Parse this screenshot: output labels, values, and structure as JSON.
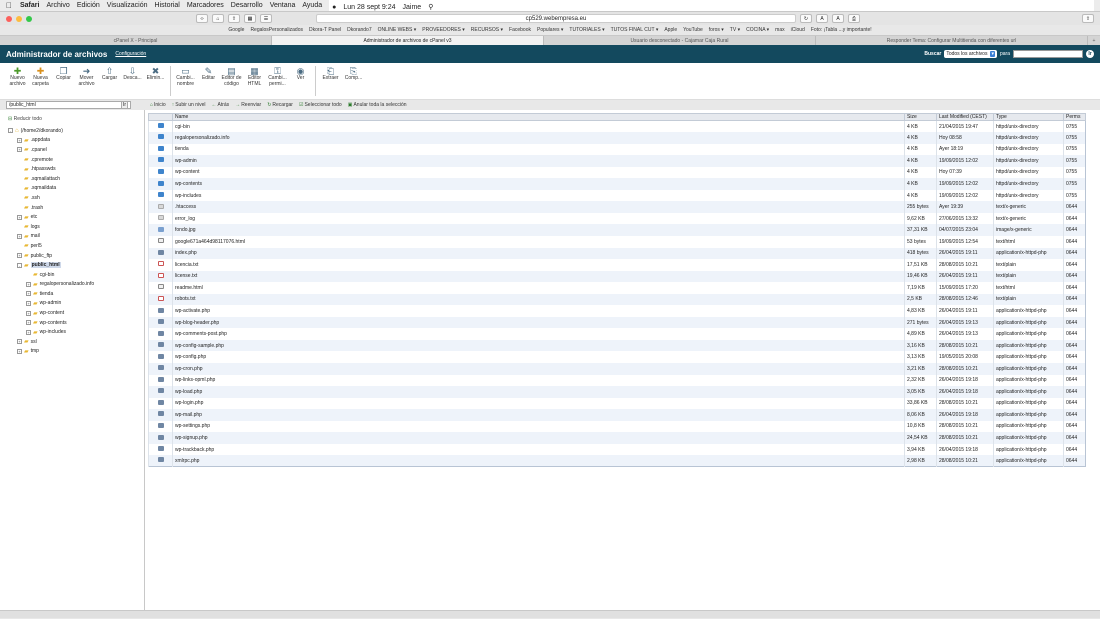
{
  "menubar": {
    "app": "Safari",
    "items": [
      "Archivo",
      "Edición",
      "Visualización",
      "Historial",
      "Marcadores",
      "Desarrollo",
      "Ventana",
      "Ayuda"
    ],
    "datetime": "Lun 28 sept 9:24",
    "user": "Jaime"
  },
  "safari": {
    "url": "cp529.webempresa.eu",
    "bookmarks": [
      "Google",
      "RegalosPersonalizados",
      "Dkora-T Panel",
      "Dkorando7",
      "ONLINE WEBS ▾",
      "PROVEEDORES ▾",
      "RECURSOS ▾",
      "Facebook",
      "Populares ▾",
      "TUTORIALES ▾",
      "TUTOS FINAL CUT ▾",
      "Apple",
      "YouTube",
      "foros ▾",
      "TV ▾",
      "COCINA ▾",
      "max",
      "iCloud",
      "Foto: ¡Tabla ...y importante!"
    ],
    "tabs": [
      {
        "label": "cPanel X - Principal",
        "active": false
      },
      {
        "label": "Administrador de archivos de cPanel v3",
        "active": true
      },
      {
        "label": "Usuario desconectado - Cajamar Caja Rural",
        "active": false
      },
      {
        "label": "Responder Tema: Configurar Multitienda con diferentes url",
        "active": false
      }
    ]
  },
  "header": {
    "title": "Administrador de archivos",
    "config_link": "Configuración",
    "search_label": "Buscar",
    "search_scope": "Todos los archivos",
    "for_label": "para",
    "go": "Ir"
  },
  "actions": [
    {
      "label": "Nuevo archivo",
      "icon": "new-file-icon",
      "color": "green"
    },
    {
      "label": "Nueva carpeta",
      "icon": "new-folder-icon",
      "color": "orange"
    },
    {
      "label": "Copiar",
      "icon": "copy-icon",
      "color": ""
    },
    {
      "label": "Mover archivo",
      "icon": "move-icon",
      "color": ""
    },
    {
      "label": "Cargar",
      "icon": "upload-icon",
      "color": ""
    },
    {
      "label": "Desca...",
      "icon": "download-icon",
      "color": ""
    },
    {
      "label": "Elimin...",
      "icon": "delete-icon",
      "color": ""
    },
    {
      "label": "Cambi... nombre",
      "icon": "rename-icon",
      "color": ""
    },
    {
      "label": "Editar",
      "icon": "edit-icon",
      "color": ""
    },
    {
      "label": "Editor de código",
      "icon": "code-editor-icon",
      "color": ""
    },
    {
      "label": "Editor HTML",
      "icon": "html-editor-icon",
      "color": ""
    },
    {
      "label": "Cambi... permi...",
      "icon": "permissions-icon",
      "color": ""
    },
    {
      "label": "Ver",
      "icon": "view-icon",
      "color": ""
    },
    {
      "label": "Extraer",
      "icon": "extract-icon",
      "color": ""
    },
    {
      "label": "Comp...",
      "icon": "compress-icon",
      "color": ""
    }
  ],
  "path_input": "/public_html",
  "path_go": "Ir",
  "navbar": [
    "Inicio",
    "Subir un nivel",
    "Atrás",
    "Reenviar",
    "Recargar",
    "Seleccionar todo",
    "Anular toda la selección"
  ],
  "tree": {
    "collapse_label": "Reducir todo",
    "items": [
      {
        "label": "(/home2/dkorando)",
        "indent": 0,
        "pm": "-",
        "selected": false
      },
      {
        "label": ".appdata",
        "indent": 1,
        "pm": "+",
        "selected": false
      },
      {
        "label": ".cpanel",
        "indent": 1,
        "pm": "+",
        "selected": false
      },
      {
        "label": ".cpremote",
        "indent": 1,
        "pm": "",
        "selected": false
      },
      {
        "label": ".htpasswds",
        "indent": 1,
        "pm": "",
        "selected": false
      },
      {
        "label": ".sqmailattach",
        "indent": 1,
        "pm": "",
        "selected": false
      },
      {
        "label": ".sqmaildata",
        "indent": 1,
        "pm": "",
        "selected": false
      },
      {
        "label": ".ssh",
        "indent": 1,
        "pm": "",
        "selected": false
      },
      {
        "label": ".trash",
        "indent": 1,
        "pm": "",
        "selected": false
      },
      {
        "label": "etc",
        "indent": 1,
        "pm": "+",
        "selected": false
      },
      {
        "label": "logs",
        "indent": 1,
        "pm": "",
        "selected": false
      },
      {
        "label": "mail",
        "indent": 1,
        "pm": "+",
        "selected": false
      },
      {
        "label": "perl5",
        "indent": 1,
        "pm": "",
        "selected": false
      },
      {
        "label": "public_ftp",
        "indent": 1,
        "pm": "+",
        "selected": false
      },
      {
        "label": "public_html",
        "indent": 1,
        "pm": "-",
        "selected": true
      },
      {
        "label": "cgi-bin",
        "indent": 2,
        "pm": "",
        "selected": false
      },
      {
        "label": "regalopersonalizado.info",
        "indent": 2,
        "pm": "+",
        "selected": false
      },
      {
        "label": "tienda",
        "indent": 2,
        "pm": "+",
        "selected": false
      },
      {
        "label": "wp-admin",
        "indent": 2,
        "pm": "+",
        "selected": false
      },
      {
        "label": "wp-content",
        "indent": 2,
        "pm": "+",
        "selected": false
      },
      {
        "label": "wp-contents",
        "indent": 2,
        "pm": "+",
        "selected": false
      },
      {
        "label": "wp-includes",
        "indent": 2,
        "pm": "+",
        "selected": false
      },
      {
        "label": "ssl",
        "indent": 1,
        "pm": "+",
        "selected": false
      },
      {
        "label": "tmp",
        "indent": 1,
        "pm": "+",
        "selected": false
      }
    ]
  },
  "table": {
    "headers": [
      "Name",
      "Size",
      "Last Modified (CEST)",
      "Type",
      "Perms"
    ],
    "rows": [
      {
        "icon": "folder",
        "name": "cgi-bin",
        "size": "4 KB",
        "modified": "21/04/2015 19:47",
        "type": "httpd/unix-directory",
        "perms": "0755"
      },
      {
        "icon": "folder",
        "name": "regalopersonalizado.info",
        "size": "4 KB",
        "modified": "Hoy 08:58",
        "type": "httpd/unix-directory",
        "perms": "0755"
      },
      {
        "icon": "folder",
        "name": "tienda",
        "size": "4 KB",
        "modified": "Ayer 18:19",
        "type": "httpd/unix-directory",
        "perms": "0755"
      },
      {
        "icon": "folder",
        "name": "wp-admin",
        "size": "4 KB",
        "modified": "19/09/2015 12:02",
        "type": "httpd/unix-directory",
        "perms": "0755"
      },
      {
        "icon": "folder",
        "name": "wp-content",
        "size": "4 KB",
        "modified": "Hoy 07:39",
        "type": "httpd/unix-directory",
        "perms": "0755"
      },
      {
        "icon": "folder",
        "name": "wp-contents",
        "size": "4 KB",
        "modified": "19/09/2015 12:02",
        "type": "httpd/unix-directory",
        "perms": "0755"
      },
      {
        "icon": "folder",
        "name": "wp-includes",
        "size": "4 KB",
        "modified": "19/09/2015 12:02",
        "type": "httpd/unix-directory",
        "perms": "0755"
      },
      {
        "icon": "generic",
        "name": ".htaccess",
        "size": "255 bytes",
        "modified": "Ayer 19:39",
        "type": "text/x-generic",
        "perms": "0644"
      },
      {
        "icon": "generic",
        "name": "error_log",
        "size": "9,62 KB",
        "modified": "27/06/2015 13:32",
        "type": "text/x-generic",
        "perms": "0644"
      },
      {
        "icon": "image",
        "name": "fondo.jpg",
        "size": "37,31 KB",
        "modified": "04/07/2015 23:04",
        "type": "image/x-generic",
        "perms": "0644"
      },
      {
        "icon": "html",
        "name": "google671a464d98117076.html",
        "size": "53 bytes",
        "modified": "19/09/2015 12:54",
        "type": "text/html",
        "perms": "0644"
      },
      {
        "icon": "php",
        "name": "index.php",
        "size": "418 bytes",
        "modified": "26/04/2015 19:11",
        "type": "application/x-httpd-php",
        "perms": "0644"
      },
      {
        "icon": "text",
        "name": "licencia.txt",
        "size": "17,51 KB",
        "modified": "28/08/2015 10:21",
        "type": "text/plain",
        "perms": "0644"
      },
      {
        "icon": "text",
        "name": "license.txt",
        "size": "19,46 KB",
        "modified": "26/04/2015 19:11",
        "type": "text/plain",
        "perms": "0644"
      },
      {
        "icon": "html",
        "name": "readme.html",
        "size": "7,19 KB",
        "modified": "15/09/2015 17:20",
        "type": "text/html",
        "perms": "0644"
      },
      {
        "icon": "text",
        "name": "robots.txt",
        "size": "2,5 KB",
        "modified": "28/08/2015 12:46",
        "type": "text/plain",
        "perms": "0644"
      },
      {
        "icon": "php",
        "name": "wp-activate.php",
        "size": "4,83 KB",
        "modified": "26/04/2015 19:11",
        "type": "application/x-httpd-php",
        "perms": "0644"
      },
      {
        "icon": "php",
        "name": "wp-blog-header.php",
        "size": "271 bytes",
        "modified": "26/04/2015 19:13",
        "type": "application/x-httpd-php",
        "perms": "0644"
      },
      {
        "icon": "php",
        "name": "wp-comments-post.php",
        "size": "4,89 KB",
        "modified": "26/04/2015 19:13",
        "type": "application/x-httpd-php",
        "perms": "0644"
      },
      {
        "icon": "php",
        "name": "wp-config-sample.php",
        "size": "3,16 KB",
        "modified": "28/08/2015 10:21",
        "type": "application/x-httpd-php",
        "perms": "0644"
      },
      {
        "icon": "php",
        "name": "wp-config.php",
        "size": "3,13 KB",
        "modified": "19/05/2015 20:08",
        "type": "application/x-httpd-php",
        "perms": "0644"
      },
      {
        "icon": "php",
        "name": "wp-cron.php",
        "size": "3,21 KB",
        "modified": "28/08/2015 10:21",
        "type": "application/x-httpd-php",
        "perms": "0644"
      },
      {
        "icon": "php",
        "name": "wp-links-opml.php",
        "size": "2,32 KB",
        "modified": "26/04/2015 19:18",
        "type": "application/x-httpd-php",
        "perms": "0644"
      },
      {
        "icon": "php",
        "name": "wp-load.php",
        "size": "3,05 KB",
        "modified": "26/04/2015 19:18",
        "type": "application/x-httpd-php",
        "perms": "0644"
      },
      {
        "icon": "php",
        "name": "wp-login.php",
        "size": "33,86 KB",
        "modified": "28/08/2015 10:21",
        "type": "application/x-httpd-php",
        "perms": "0644"
      },
      {
        "icon": "php",
        "name": "wp-mail.php",
        "size": "8,06 KB",
        "modified": "26/04/2015 19:18",
        "type": "application/x-httpd-php",
        "perms": "0644"
      },
      {
        "icon": "php",
        "name": "wp-settings.php",
        "size": "10,8 KB",
        "modified": "28/08/2015 10:21",
        "type": "application/x-httpd-php",
        "perms": "0644"
      },
      {
        "icon": "php",
        "name": "wp-signup.php",
        "size": "24,54 KB",
        "modified": "28/08/2015 10:21",
        "type": "application/x-httpd-php",
        "perms": "0644"
      },
      {
        "icon": "php",
        "name": "wp-trackback.php",
        "size": "3,94 KB",
        "modified": "26/04/2015 19:18",
        "type": "application/x-httpd-php",
        "perms": "0644"
      },
      {
        "icon": "php",
        "name": "xmlrpc.php",
        "size": "2,98 KB",
        "modified": "28/08/2015 10:21",
        "type": "application/x-httpd-php",
        "perms": "0644"
      }
    ]
  }
}
